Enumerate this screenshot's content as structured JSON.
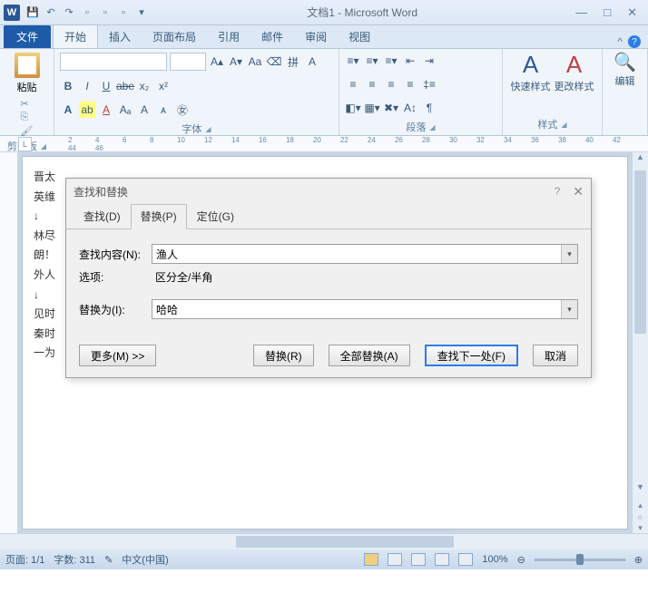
{
  "titlebar": {
    "title": "文档1 - Microsoft Word"
  },
  "tabs": {
    "file": "文件",
    "items": [
      "开始",
      "插入",
      "页面布局",
      "引用",
      "邮件",
      "审阅",
      "视图"
    ]
  },
  "ribbon": {
    "clipboard": {
      "paste": "粘贴",
      "label": "剪贴板"
    },
    "font": {
      "label": "字体"
    },
    "paragraph": {
      "label": "段落"
    },
    "styles": {
      "quick": "快速样式",
      "change": "更改样式",
      "label": "样式"
    },
    "editing": {
      "label": "编辑"
    }
  },
  "ruler": {
    "marks": [
      "2",
      "4",
      "6",
      "8",
      "10",
      "12",
      "14",
      "16",
      "18",
      "20",
      "22",
      "24",
      "26",
      "28",
      "30",
      "32",
      "34",
      "36",
      "38",
      "40",
      "42",
      "44",
      "46"
    ]
  },
  "doc": {
    "lines": [
      "晋太",
      "英维",
      "↓",
      "林尽",
      "朗！",
      "外人",
      "↓",
      "见时",
      "秦时",
      "一为"
    ]
  },
  "dialog": {
    "title": "查找和替换",
    "tabs": {
      "find": "查找(D)",
      "replace": "替换(P)",
      "goto": "定位(G)"
    },
    "find_label": "查找内容(N):",
    "find_value": "渔人",
    "options_label": "选项:",
    "options_value": "区分全/半角",
    "replace_label": "替换为(I):",
    "replace_value": "哈哈",
    "buttons": {
      "more": "更多(M) >>",
      "replace": "替换(R)",
      "replace_all": "全部替换(A)",
      "find_next": "查找下一处(F)",
      "cancel": "取消"
    }
  },
  "status": {
    "page": "页面: 1/1",
    "words": "字数: 311",
    "lang": "中文(中国)",
    "zoom": "100%"
  }
}
